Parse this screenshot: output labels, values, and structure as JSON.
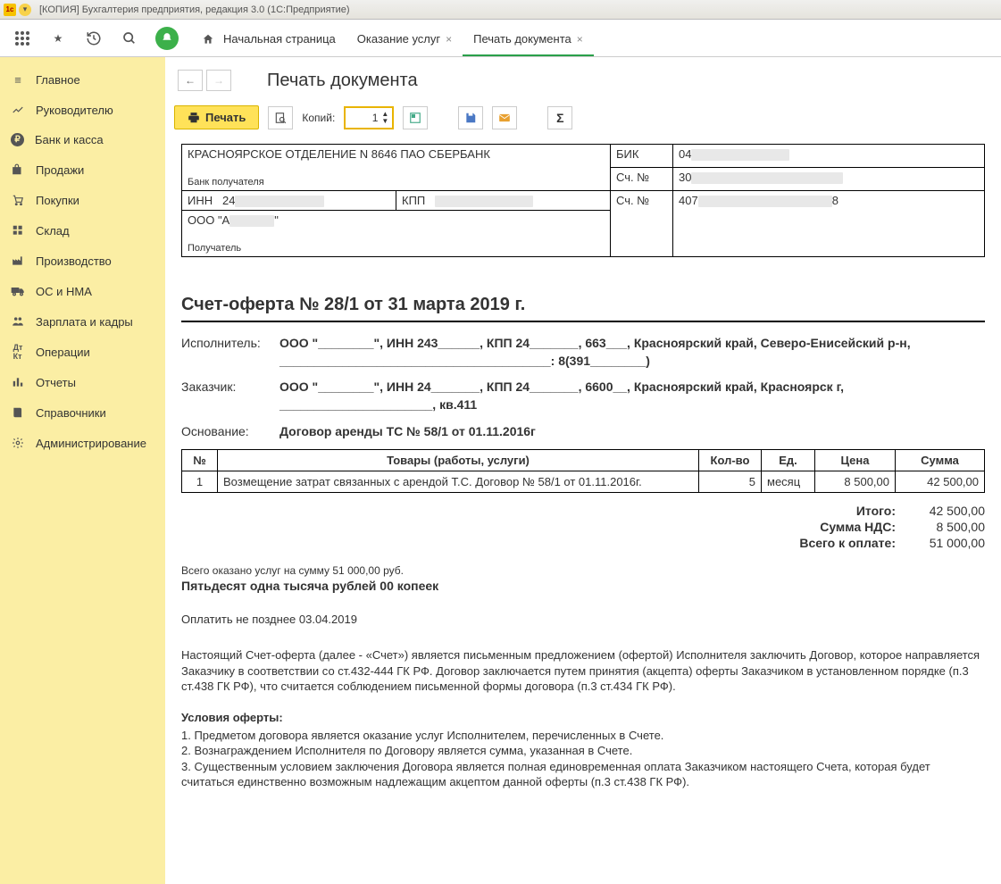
{
  "titlebar": "[КОПИЯ] Бухгалтерия предприятия, редакция 3.0  (1С:Предприятие)",
  "tabs": {
    "home": "Начальная страница",
    "t1": "Оказание услуг",
    "t2": "Печать документа"
  },
  "page_title": "Печать документа",
  "toolbar": {
    "print": "Печать",
    "copies_label": "Копий:",
    "copies_value": "1"
  },
  "sidebar": [
    "Главное",
    "Руководителю",
    "Банк и касса",
    "Продажи",
    "Покупки",
    "Склад",
    "Производство",
    "ОС и НМА",
    "Зарплата и кадры",
    "Операции",
    "Отчеты",
    "Справочники",
    "Администрирование"
  ],
  "bank": {
    "bank_name": "КРАСНОЯРСКОЕ ОТДЕЛЕНИЕ N 8646 ПАО СБЕРБАНК",
    "bank_recipient_lbl": "Банк получателя",
    "bik_lbl": "БИК",
    "bik_val": "04",
    "acc1_lbl": "Сч. №",
    "acc1_val": "30",
    "inn_lbl": "ИНН",
    "inn_val": "24",
    "kpp_lbl": "КПП",
    "acc2_lbl": "Сч. №",
    "acc2_val_a": "407",
    "acc2_val_b": "8",
    "org": "ООО \"А",
    "recipient_lbl": "Получатель"
  },
  "invoice": {
    "title": "Счет-оферта № 28/1 от 31 марта 2019 г.",
    "executor_lbl": "Исполнитель:",
    "executor_val": "ООО \"________\", ИНН 243______, КПП 24_______, 663___, Красноярский край, Северо-Енисейский р-н, _______________________________________: 8(391________)",
    "customer_lbl": "Заказчик:",
    "customer_val": "ООО \"________\", ИНН 24_______, КПП 24_______, 6600__, Красноярский край, Красноярск г, ______________________, кв.411",
    "basis_lbl": "Основание:",
    "basis_val": "Договор аренды ТС № 58/1 от 01.11.2016г"
  },
  "items": {
    "headers": {
      "num": "№",
      "name": "Товары (работы, услуги)",
      "qty": "Кол-во",
      "unit": "Ед.",
      "price": "Цена",
      "sum": "Сумма"
    },
    "rows": [
      {
        "num": "1",
        "name": "Возмещение затрат связанных с арендой Т.С. Договор № 58/1 от 01.11.2016г.",
        "qty": "5",
        "unit": "месяц",
        "price": "8 500,00",
        "sum": "42 500,00"
      }
    ]
  },
  "totals": {
    "itogo_lbl": "Итого:",
    "itogo": "42 500,00",
    "nds_lbl": "Сумма НДС:",
    "nds": "8 500,00",
    "total_lbl": "Всего к оплате:",
    "total": "51 000,00"
  },
  "sumtext": "Всего оказано услуг на сумму 51 000,00 руб.",
  "sumwords": "Пятьдесят одна тысяча рублей 00 копеек",
  "paytill": "Оплатить не позднее 03.04.2019",
  "offer_p1": "Настоящий Счет-оферта (далее - «Счет») является письменным предложением (офертой) Исполнителя заключить Договор, которое направляется Заказчику в соответствии со ст.432-444 ГК РФ.  Договор заключается путем принятия (акцепта) оферты Заказчиком в установленном порядке (п.3 ст.438 ГК РФ), что считается соблюдением письменной формы договора (п.3 ст.434 ГК РФ).",
  "offer_hdr": "Условия оферты:",
  "offer_l1": "1. Предметом договора является оказание услуг Исполнителем, перечисленных в Счете.",
  "offer_l2": "2. Вознаграждением Исполнителя по Договору является сумма, указанная в Счете.",
  "offer_l3": "3. Существенным условием заключения Договора является полная единовременная оплата Заказчиком настоящего Счета, которая будет считаться единственно возможным надлежащим акцептом данной оферты (п.3 ст.438 ГК РФ)."
}
